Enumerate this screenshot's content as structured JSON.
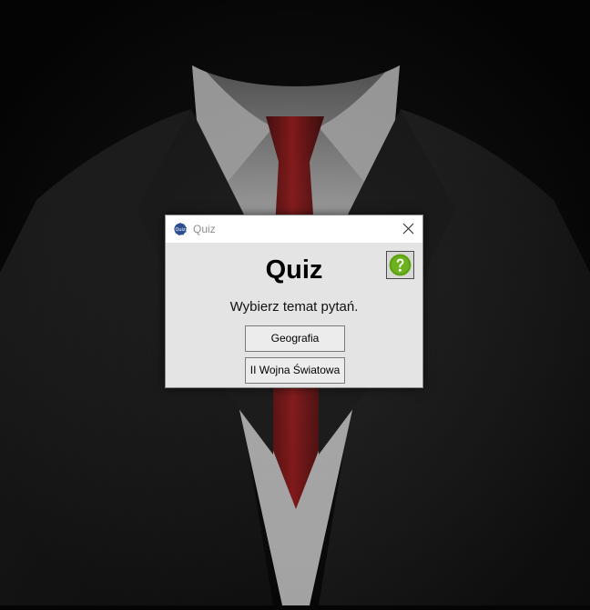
{
  "window": {
    "title": "Quiz"
  },
  "main": {
    "heading": "Quiz",
    "prompt": "Wybierz temat pytań.",
    "topics": [
      {
        "label": "Geografia"
      },
      {
        "label": "II Wojna Światowa"
      }
    ]
  },
  "icons": {
    "app": "quiz-app-icon",
    "close": "close-icon",
    "help": "help-icon"
  },
  "colors": {
    "help_icon_green": "#6cb21c",
    "tie_red": "#a11416",
    "desktop_dark": "#050505"
  }
}
